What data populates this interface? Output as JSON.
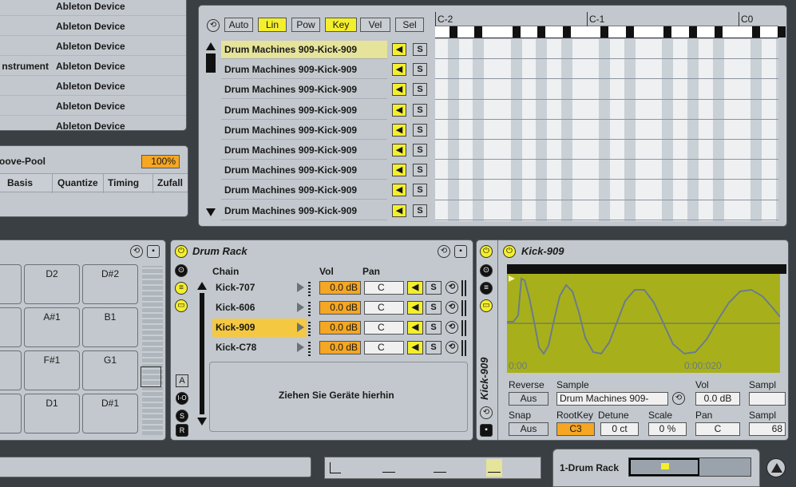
{
  "browser": {
    "rows": [
      {
        "col1": "",
        "col2": "Ableton Device"
      },
      {
        "col1": "",
        "col2": "Ableton Device"
      },
      {
        "col1": "",
        "col2": "Ableton Device"
      },
      {
        "col1": "nstrument",
        "col2": "Ableton Device"
      },
      {
        "col1": "",
        "col2": "Ableton Device"
      },
      {
        "col1": "",
        "col2": "Ableton Device"
      },
      {
        "col1": "",
        "col2": "Ableton Device"
      }
    ]
  },
  "groove": {
    "title": "oove-Pool",
    "amount": "100%",
    "headers": [
      "Basis",
      "Quantize",
      "Timing",
      "Zufall"
    ]
  },
  "key_editor": {
    "buttons": [
      "Auto",
      "Lin",
      "Pow",
      "Key",
      "Vel",
      "Sel"
    ],
    "active": [
      "Lin",
      "Key"
    ],
    "ruler": [
      "C-2",
      "C-1",
      "C0"
    ],
    "lanes": [
      "Drum Machines 909-Kick-909",
      "Drum Machines 909-Kick-909",
      "Drum Machines 909-Kick-909",
      "Drum Machines 909-Kick-909",
      "Drum Machines 909-Kick-909",
      "Drum Machines 909-Kick-909",
      "Drum Machines 909-Kick-909",
      "Drum Machines 909-Kick-909",
      "Drum Machines 909-Kick-909"
    ],
    "solo_label": "S"
  },
  "pads": {
    "rows": [
      [
        "2",
        "D2",
        "D#2"
      ],
      [
        "",
        "A#1",
        "B1"
      ],
      [
        "",
        "F#1",
        "G1"
      ],
      [
        "1",
        "D1",
        "D#1"
      ]
    ]
  },
  "rack": {
    "title": "Drum Rack",
    "col_chain": "Chain",
    "col_vol": "Vol",
    "col_pan": "Pan",
    "chains": [
      {
        "name": "Kick-707",
        "vol": "0.0 dB",
        "pan": "C"
      },
      {
        "name": "Kick-606",
        "vol": "0.0 dB",
        "pan": "C"
      },
      {
        "name": "Kick-909",
        "vol": "0.0 dB",
        "pan": "C"
      },
      {
        "name": "Kick-C78",
        "vol": "0.0 dB",
        "pan": "C"
      }
    ],
    "selected": "Kick-909",
    "drop_hint": "Ziehen Sie Geräte hierhin",
    "side_buttons": [
      "A",
      "I-O",
      "S",
      "R"
    ]
  },
  "simpler": {
    "title": "Kick-909",
    "vertical_title": "Kick-909",
    "time_start": "0:00",
    "time_mid": "0:00:020",
    "labels": {
      "reverse": "Reverse",
      "sample": "Sample",
      "vol": "Vol",
      "sampl": "Sampl",
      "snap": "Snap",
      "rootkey": "RootKey",
      "detune": "Detune",
      "scale": "Scale",
      "pan": "Pan",
      "sampl2": "Sampl"
    },
    "values": {
      "reverse": "Aus",
      "sample": "Drum Machines 909-",
      "vol": "0.0 dB",
      "snap": "Aus",
      "rootkey": "C3",
      "detune": "0 ct",
      "scale": "0 %",
      "pan": "C",
      "sampl2": "68"
    }
  },
  "footer": {
    "track": "1-Drum Rack"
  },
  "colors": {
    "accent_yellow": "#f4ef2c",
    "orange": "#f5a623",
    "panel": "#c2c8cd",
    "wave_bg": "#a7b01b"
  }
}
